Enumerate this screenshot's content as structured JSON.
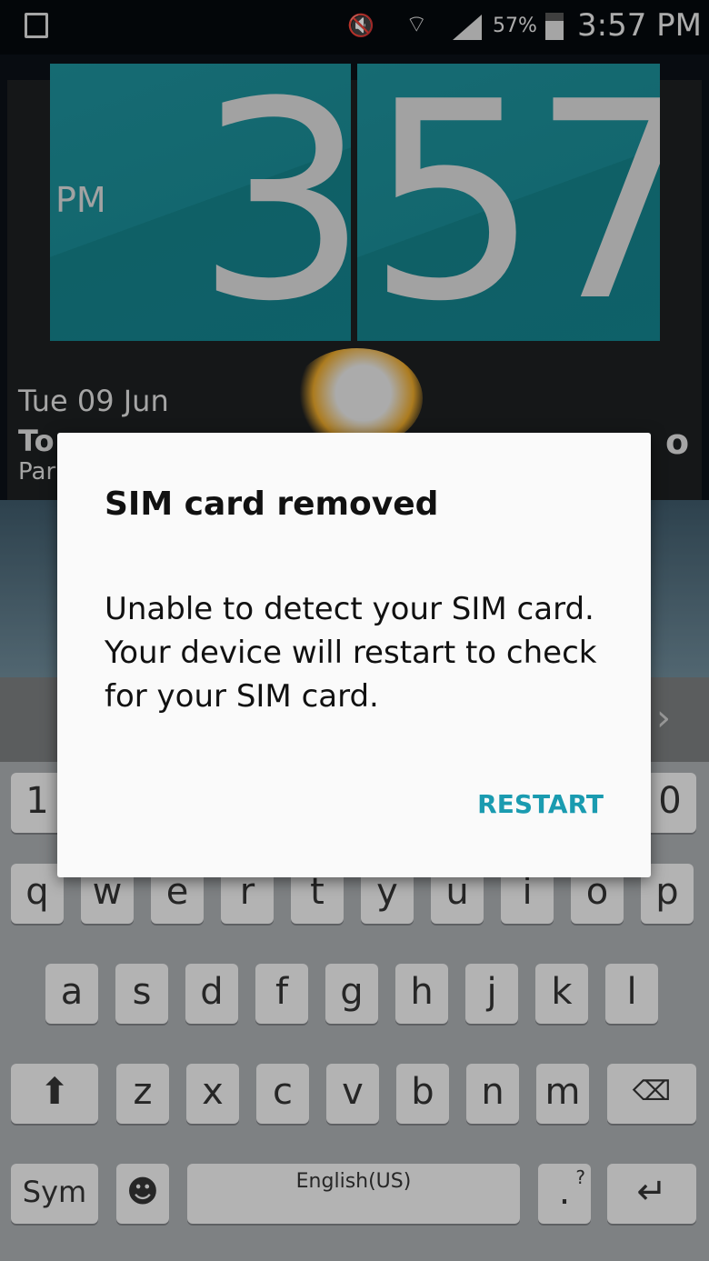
{
  "status_bar": {
    "battery": "57%",
    "time": "3:57 PM",
    "icons": [
      "gallery-notification-icon",
      "mute-vibrate-icon",
      "wifi-icon",
      "signal-icon",
      "battery-icon"
    ]
  },
  "clock_widget": {
    "ampm": "PM",
    "hour": "3",
    "minutes": "57",
    "date": "Tue 09 Jun",
    "partial_text_1": "To",
    "partial_text_2": "Par",
    "partial_temp": "o"
  },
  "keyboard": {
    "number_row_visible": [
      "1",
      "0"
    ],
    "row1": [
      "q",
      "w",
      "e",
      "r",
      "t",
      "y",
      "u",
      "i",
      "o",
      "p"
    ],
    "row2": [
      "a",
      "s",
      "d",
      "f",
      "g",
      "h",
      "j",
      "k",
      "l"
    ],
    "row3": [
      "z",
      "x",
      "c",
      "v",
      "b",
      "n",
      "m"
    ],
    "sym": "Sym",
    "space_label": "English(US)",
    "period": ".",
    "period_hint": "?"
  },
  "dialog": {
    "title": "SIM card removed",
    "body": "Unable to detect your SIM card. Your device will restart to check for your SIM card.",
    "button": "RESTART",
    "accent": "#1a9bb0"
  }
}
